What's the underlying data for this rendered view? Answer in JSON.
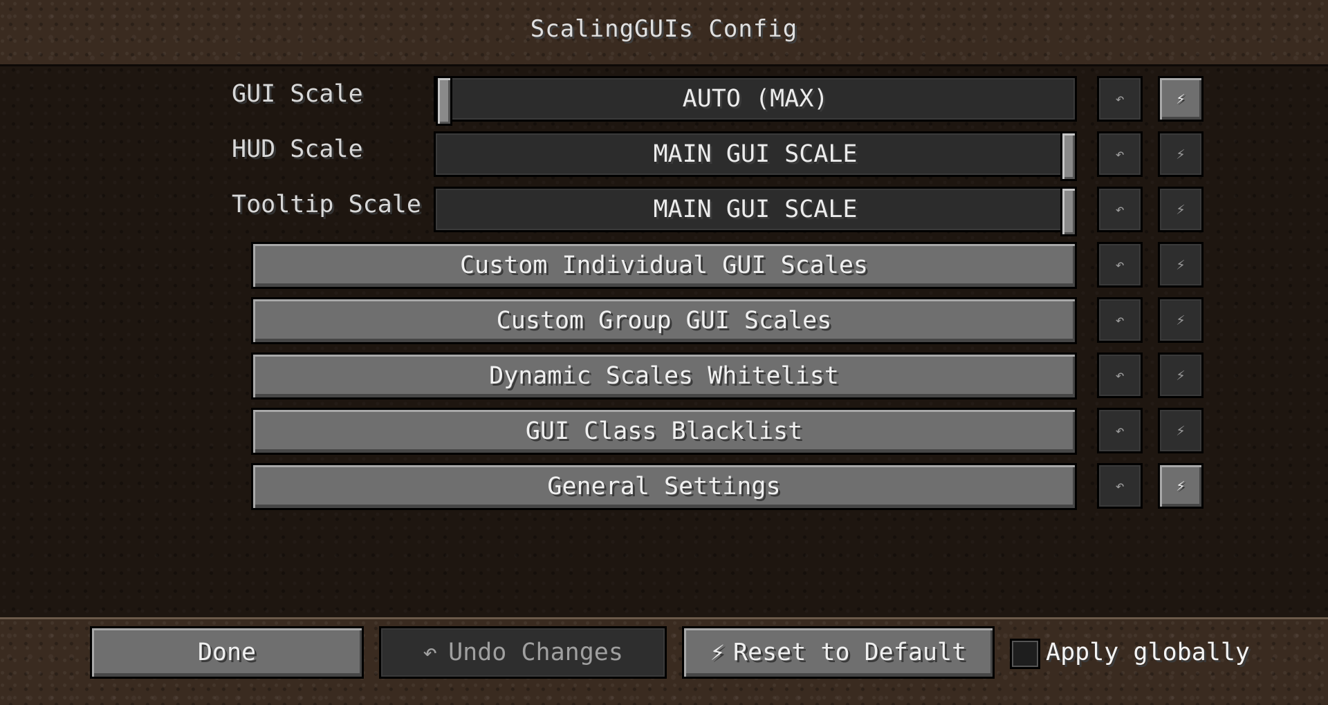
{
  "header": {
    "title": "ScalingGUIs Config"
  },
  "icons": {
    "undo": "↶",
    "reset": "⚡︎",
    "undo_icon": "undo-arrow-icon",
    "reset_icon": "reset-lightning-icon"
  },
  "options": [
    {
      "label": "GUI Scale",
      "value": "AUTO (MAX)",
      "slider_level": 0
    },
    {
      "label": "HUD Scale",
      "value": "MAIN GUI SCALE",
      "slider_level": 1
    },
    {
      "label": "Tooltip Scale",
      "value": "MAIN GUI SCALE",
      "slider_level": 1
    }
  ],
  "categories": [
    "Custom Individual GUI Scales",
    "Custom Group GUI Scales",
    "Dynamic Scales Whitelist",
    "GUI Class Blacklist",
    "General Settings"
  ],
  "footer": {
    "done_label": "Done",
    "undo_label": "Undo Changes",
    "reset_label": "Reset to Default",
    "apply_globally_label": "Apply globally",
    "apply_globally_checked": false
  }
}
